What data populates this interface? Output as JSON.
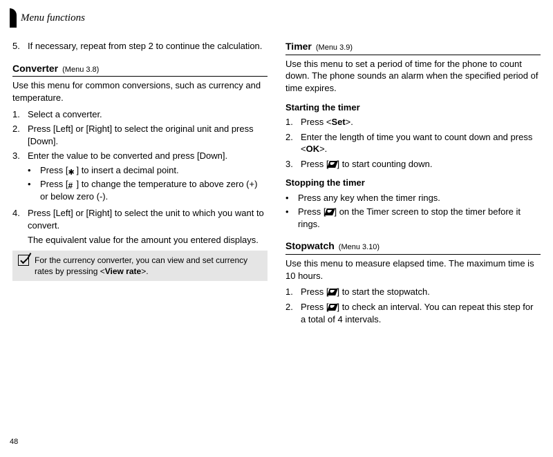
{
  "header": "Menu functions",
  "pageNumber": "48",
  "left": {
    "step5_num": "5.",
    "step5": "If necessary, repeat from step 2 to continue the calculation.",
    "converter_title": "Converter",
    "converter_menu": "(Menu 3.8)",
    "converter_intro": "Use this menu for common conversions, such as currency and temperature.",
    "c1_num": "1.",
    "c1": "Select a converter.",
    "c2_num": "2.",
    "c2": "Press [Left] or [Right] to select the original unit and press [Down].",
    "c3_num": "3.",
    "c3": "Enter the value to be converted and press [Down].",
    "c3b1_a": "Press [",
    "c3b1_b": "] to insert a decimal point.",
    "c3b2_a": "Press [",
    "c3b2_b": "] to change the temperature to above zero (+) or below zero (-).",
    "c4_num": "4.",
    "c4": "Press [Left] or [Right] to select the unit to which you want to convert.",
    "c4_after": "The equivalent value for the amount you entered displays.",
    "note_a": "For the currency converter, you can view and set currency rates by pressing <",
    "note_bold": "View rate",
    "note_b": ">."
  },
  "right": {
    "timer_title": "Timer",
    "timer_menu": "(Menu 3.9)",
    "timer_intro": "Use this menu to set a period of time for the phone to count down. The phone sounds an alarm when the specified period of time expires.",
    "start_head": "Starting the timer",
    "t1_num": "1.",
    "t1_a": "Press <",
    "t1_bold": "Set",
    "t1_b": ">.",
    "t2_num": "2.",
    "t2_a": "Enter the length of time you want to count down and press <",
    "t2_bold": "OK",
    "t2_b": ">.",
    "t3_num": "3.",
    "t3_a": "Press [",
    "t3_b": "] to start counting down.",
    "stop_head": "Stopping the timer",
    "sb1": "Press any key when the timer rings.",
    "sb2_a": "Press [",
    "sb2_b": "] on the Timer screen to stop the timer before it rings.",
    "sw_title": "Stopwatch",
    "sw_menu": "(Menu 3.10)",
    "sw_intro": "Use this menu to measure elapsed time. The maximum time is 10 hours.",
    "sw1_num": "1.",
    "sw1_a": "Press [",
    "sw1_b": "] to start the stopwatch.",
    "sw2_num": "2.",
    "sw2_a": "Press [",
    "sw2_b": "] to check an interval. You can repeat this step for a total of 4 intervals."
  }
}
